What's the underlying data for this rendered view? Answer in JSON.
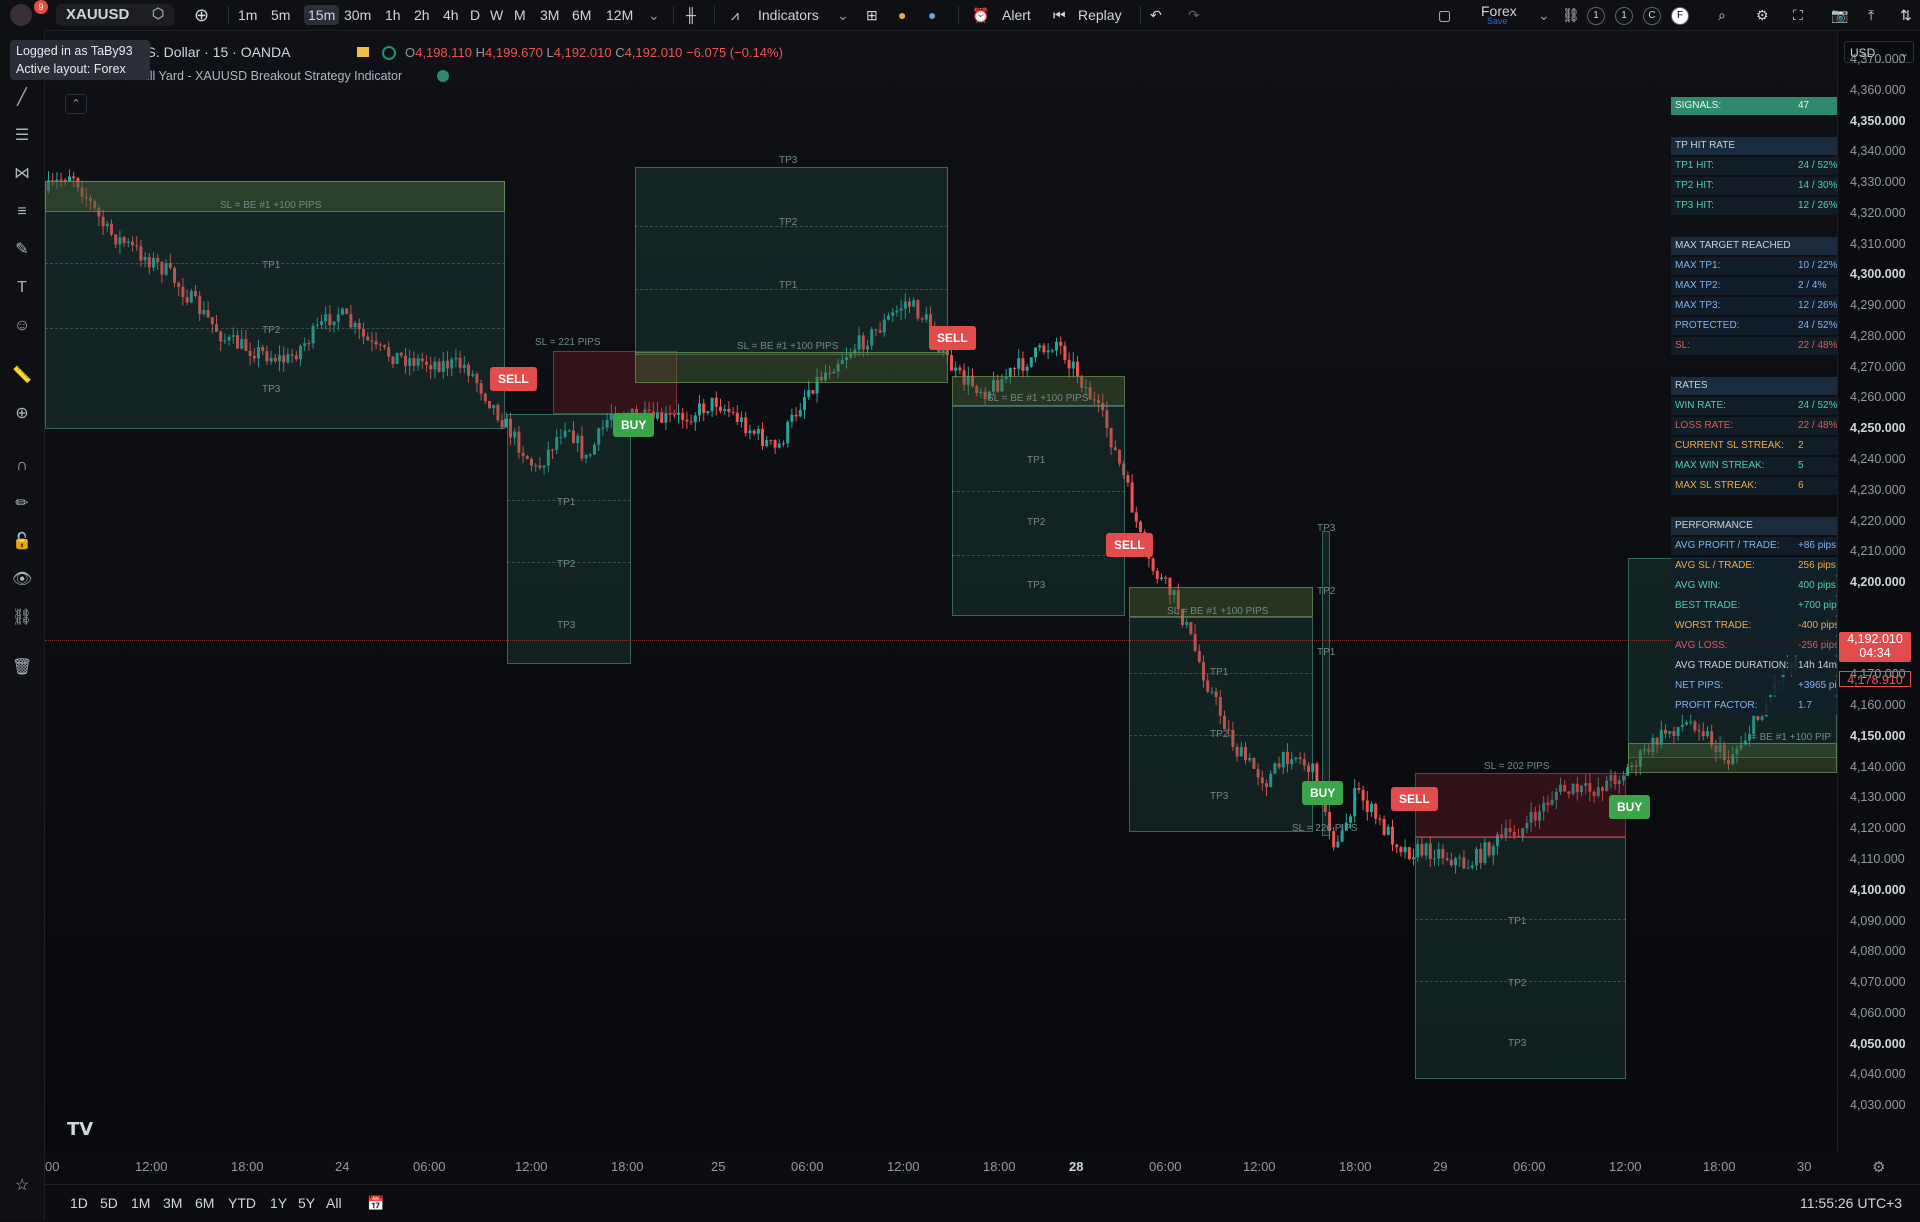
{
  "app": {
    "notification_count": "9"
  },
  "toolbar": {
    "symbol": "XAUUSD",
    "intervals": [
      "1m",
      "5m",
      "15m",
      "30m",
      "1h",
      "2h",
      "4h",
      "D",
      "W",
      "M",
      "3M",
      "6M",
      "12M"
    ],
    "selected_interval": "15m",
    "indicators_label": "Indicators",
    "alert_label": "Alert",
    "replay_label": "Replay",
    "layout_name": "Forex",
    "layout_status": "Save",
    "small_badges": [
      "1",
      "1",
      "C",
      "F"
    ]
  },
  "tooltip": {
    "line1": "Logged in as TaBy93",
    "line2": "Active layout: Forex"
  },
  "legend": {
    "symbol_title": "t / U.S. Dollar · 15 · OANDA",
    "open": "4,198.110",
    "high": "4,199.670",
    "low": "4,192.010",
    "close": "4,192.010",
    "change": "−6.075 (−0.14%)",
    "indicator_name": "The Arcane Bull Yard - XAUUSD Breakout Strategy Indicator"
  },
  "currency_select": "USD",
  "price_axis": [
    "4,370.000",
    "4,360.000",
    "4,350.000",
    "4,340.000",
    "4,330.000",
    "4,320.000",
    "4,310.000",
    "4,300.000",
    "4,290.000",
    "4,280.000",
    "4,270.000",
    "4,260.000",
    "4,250.000",
    "4,240.000",
    "4,230.000",
    "4,220.000",
    "4,210.000",
    "4,200.000",
    "4,170.000",
    "4,160.000",
    "4,150.000",
    "4,140.000",
    "4,130.000",
    "4,120.000",
    "4,110.000",
    "4,100.000",
    "4,090.000",
    "4,080.000",
    "4,070.000",
    "4,060.000",
    "4,050.000",
    "4,040.000",
    "4,030.000"
  ],
  "price_axis_bold": [
    "4,350.000",
    "4,300.000",
    "4,250.000",
    "4,200.000",
    "4,150.000",
    "4,100.000",
    "4,050.000"
  ],
  "current_price": {
    "value": "4,192.010",
    "countdown": "04:34",
    "secondary": "4,178.910"
  },
  "time_axis": [
    "00",
    "12:00",
    "18:00",
    "24",
    "06:00",
    "12:00",
    "18:00",
    "25",
    "06:00",
    "12:00",
    "18:00",
    "28",
    "06:00",
    "12:00",
    "18:00",
    "29",
    "06:00",
    "12:00",
    "18:00",
    "30"
  ],
  "time_axis_bold": [
    "28"
  ],
  "bottom": {
    "ranges": [
      "1D",
      "5D",
      "1M",
      "3M",
      "6M",
      "YTD",
      "1Y",
      "5Y",
      "All"
    ],
    "clock": "11:55:26 UTC+3"
  },
  "zone_labels": {
    "tp1": "TP1",
    "tp2": "TP2",
    "tp3": "TP3",
    "sl_be_100": "SL = BE #1 +100 PIPS",
    "sl_221": "SL = 221 PIPS",
    "sl_202": "SL = 202 PIPS",
    "sl_226": "SL = 226 PIPS",
    "sl_be_100_partial": "= BE #1 +100 PIP"
  },
  "signals": {
    "sell": "SELL",
    "buy": "BUY"
  },
  "stats_panel": [
    {
      "k": "SIGNALS:",
      "v": "47",
      "style": "green"
    },
    {
      "k": "TP HIT RATE",
      "v": "",
      "style": "head"
    },
    {
      "k": "TP1 HIT:",
      "v": "24 / 52%",
      "color": "#4fd1a5"
    },
    {
      "k": "TP2 HIT:",
      "v": "14 / 30%",
      "color": "#4fd1a5"
    },
    {
      "k": "TP3 HIT:",
      "v": "12 / 26%",
      "color": "#4fd1a5"
    },
    {
      "k": "MAX TARGET REACHED",
      "v": "",
      "style": "head"
    },
    {
      "k": "MAX TP1:",
      "v": "10 / 22%",
      "color": "#7fb3e8"
    },
    {
      "k": "MAX TP2:",
      "v": "2 / 4%",
      "color": "#7fb3e8"
    },
    {
      "k": "MAX TP3:",
      "v": "12 / 26%",
      "color": "#7fb3e8"
    },
    {
      "k": "PROTECTED:",
      "v": "24 / 52%",
      "color": "#7fb3e8"
    },
    {
      "k": "SL:",
      "v": "22 / 48%",
      "color": "#e2585a"
    },
    {
      "k": "RATES",
      "v": "",
      "style": "head"
    },
    {
      "k": "WIN RATE:",
      "v": "24 / 52%",
      "color": "#4fd1a5"
    },
    {
      "k": "LOSS RATE:",
      "v": "22 / 48%",
      "color": "#e2585a"
    },
    {
      "k": "CURRENT SL STREAK:",
      "v": "2",
      "color": "#f0a94a"
    },
    {
      "k": "MAX WIN STREAK:",
      "v": "5",
      "color": "#4fd1a5"
    },
    {
      "k": "MAX SL STREAK:",
      "v": "6",
      "color": "#f0a94a"
    },
    {
      "k": "PERFORMANCE",
      "v": "",
      "style": "head"
    },
    {
      "k": "AVG PROFIT / TRADE:",
      "v": "+86 pips",
      "color": "#7fb3e8"
    },
    {
      "k": "AVG SL / TRADE:",
      "v": "256 pips",
      "color": "#f0a94a"
    },
    {
      "k": "AVG WIN:",
      "v": "400 pips",
      "color": "#4fd1a5"
    },
    {
      "k": "BEST TRADE:",
      "v": "+700 pips",
      "color": "#4fd1a5"
    },
    {
      "k": "WORST TRADE:",
      "v": "-400 pips",
      "color": "#f0a94a"
    },
    {
      "k": "AVG LOSS:",
      "v": "-256 pips",
      "color": "#e2585a"
    },
    {
      "k": "AVG TRADE DURATION:",
      "v": "14h 14m",
      "color": "#c7d0db"
    },
    {
      "k": "NET PIPS:",
      "v": "+3965 pips",
      "color": "#7fb3e8"
    },
    {
      "k": "PROFIT FACTOR:",
      "v": "1.7",
      "color": "#7fb3e8"
    }
  ],
  "colors": {
    "up": "#26a69a",
    "down": "#ef5350",
    "sell_badge": "#e24c4c",
    "buy_badge": "#3aa44a",
    "price_tag": "#e24c4c"
  },
  "icons": {
    "left_tools": [
      "trend-line-icon",
      "horizontal-lines-icon",
      "pattern-icon",
      "fib-icon",
      "brush-icon",
      "text-icon",
      "emoji-icon",
      "ruler-icon",
      "zoom-icon",
      "magnet-icon",
      "lock-drawing-icon",
      "unlock-icon",
      "eye-icon",
      "link-icon",
      "trash-icon",
      "star-icon"
    ]
  }
}
